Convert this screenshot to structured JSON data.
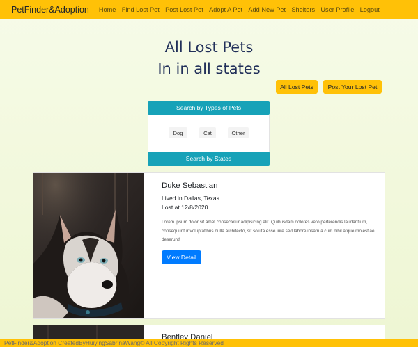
{
  "navbar": {
    "brand": "PetFinder&Adoption",
    "links": [
      "Home",
      "Find Lost Pet",
      "Post Lost Pet",
      "Adopt A Pet",
      "Add New Pet",
      "Shelters",
      "User Profile",
      "Logout"
    ]
  },
  "page": {
    "title_line1": "All Lost Pets",
    "title_line2": "In in all states"
  },
  "actions": {
    "all_lost_pets": "All Lost Pets",
    "post_lost_pet": "Post Your Lost Pet"
  },
  "search": {
    "types_header": "Search by Types of Pets",
    "types": [
      "Dog",
      "Cat",
      "Other"
    ],
    "states_header": "Search by States"
  },
  "pets": [
    {
      "name": "Duke Sebastian",
      "location": "Lived in Dallas, Texas",
      "lost": "Lost at 12/8/2020",
      "description": "Lorem ipsum dolor sit amet consectetur adipisicing elit. Quibusdam dolores vero perferendis laudantium, consequuntur voluptatibus nulla architecto, sit soluta esse iure sed labore ipsam a cum nihil atque molestiae deserunt!",
      "button": "View Detail"
    },
    {
      "name": "Bentley Daniel"
    }
  ],
  "footer": {
    "text": "PetFinder&Adoption CreatedByHuiyingSabrinaWang© All Copyright Rights Reserved"
  },
  "colors": {
    "navbar": "#ffc107",
    "teal": "#17a2b8",
    "primary": "#007bff"
  }
}
